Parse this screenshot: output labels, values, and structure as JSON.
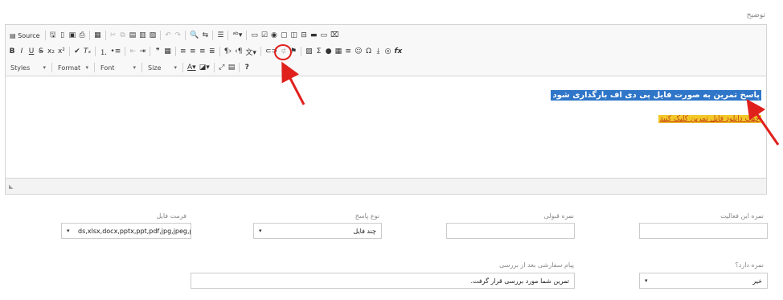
{
  "description_label": "توضیح",
  "toolbar": {
    "source_label": "Source",
    "styles_label": "Styles",
    "format_label": "Format",
    "font_label": "Font",
    "size_label": "Size",
    "row1_icons": [
      "source-icon",
      "save-icon",
      "new-page-icon",
      "preview-icon",
      "print-icon",
      "templates-icon",
      "cut-icon",
      "copy-icon",
      "paste-icon",
      "paste-text-icon",
      "paste-word-icon",
      "undo-icon",
      "redo-icon",
      "find-icon",
      "replace-icon",
      "select-all-icon",
      "spellcheck-icon",
      "form-icon",
      "checkbox-icon",
      "radio-icon",
      "textfield-icon",
      "textarea-icon",
      "select-icon",
      "button-icon",
      "image-button-icon",
      "hidden-field-icon"
    ],
    "row2_icons": [
      "bold-icon",
      "italic-icon",
      "underline-icon",
      "strike-icon",
      "subscript-icon",
      "superscript-icon",
      "copy-format-icon",
      "remove-format-icon",
      "numbered-list-icon",
      "bulleted-list-icon",
      "outdent-icon",
      "indent-icon",
      "blockquote-icon",
      "div-icon",
      "align-left-icon",
      "align-center-icon",
      "align-right-icon",
      "justify-icon",
      "ltr-icon",
      "rtl-icon",
      "language-icon",
      "link-icon",
      "unlink-icon",
      "anchor-icon",
      "image-icon",
      "math-icon",
      "flash-icon",
      "table-icon",
      "hr-icon",
      "smiley-icon",
      "special-char-icon",
      "page-break-icon",
      "iframe-icon",
      "formula-icon"
    ],
    "row3_icons": [
      "text-color-icon",
      "bg-color-icon",
      "maximize-icon",
      "show-blocks-icon",
      "about-icon"
    ]
  },
  "editor": {
    "line1": "پاسخ تمرین به صورت فایل پی دی اف بارگذاری شود",
    "line2": "جهت دانلود فایل تمرین کلیک کنید",
    "highlight_color": "#2f76c9",
    "marker_color": "#f2c829",
    "annotation_color": "#e0201c"
  },
  "form": {
    "activity_score_label": "نمره این فعالیت",
    "activity_score_value": "",
    "pass_score_label": "نمره قبولی",
    "pass_score_value": "",
    "answer_type_label": "نوع پاسخ",
    "answer_type_value": "چند فایل",
    "file_format_label": "فرمت فایل",
    "file_format_value": "ds,xlsx,docx,pptx,ppt,pdf,jpg,jpeg,png,gif",
    "has_score_label": "نمره دارد؟",
    "has_score_value": "خیر",
    "custom_message_label": "پیام سفارشی بعد از بررسی",
    "custom_message_value": "تمرین شما مورد بررسی قرار گرفت."
  }
}
